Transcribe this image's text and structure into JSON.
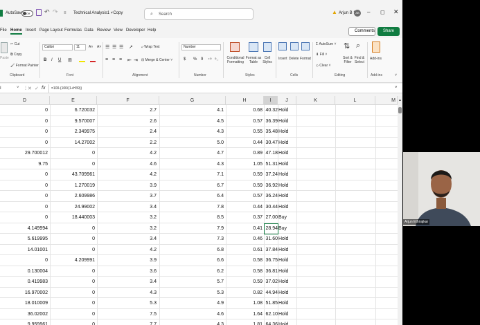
{
  "titlebar": {
    "autosave_label": "AutoSave",
    "autosave_state": "Off",
    "doc_title": "Technical Analysis1 - Copy",
    "search_placeholder": "Search",
    "user_name": "Arjun B S",
    "user_initials": "AB"
  },
  "tabs": [
    "File",
    "Home",
    "Insert",
    "Page Layout",
    "Formulas",
    "Data",
    "Review",
    "View",
    "Developer",
    "Help"
  ],
  "active_tab": "Home",
  "comments_label": "Comments",
  "share_label": "Share",
  "ribbon": {
    "clipboard": {
      "cut": "Cut",
      "copy": "Copy",
      "paste": "Paste",
      "format_painter": "Format Painter",
      "group": "Clipboard"
    },
    "font": {
      "name": "Calibri",
      "size": "11",
      "group": "Font",
      "bold": "B",
      "italic": "I",
      "underline": "U",
      "grow": "A˄",
      "shrink": "A˅"
    },
    "alignment": {
      "wrap": "Wrap Text",
      "merge": "Merge & Center",
      "group": "Alignment"
    },
    "number": {
      "format": "Number",
      "currency": "$",
      "percent": "%",
      "comma": "9",
      "group": "Number"
    },
    "styles": {
      "conditional": "Conditional Formatting",
      "format_as_table": "Format as Table",
      "cell_styles": "Cell Styles",
      "group": "Styles"
    },
    "cells": {
      "insert": "Insert",
      "delete": "Delete",
      "format": "Format",
      "group": "Cells"
    },
    "editing": {
      "autosum": "AutoSum",
      "fill": "Fill",
      "clear": "Clear",
      "sort": "Sort & Filter",
      "find": "Find & Select",
      "group": "Editing"
    },
    "addins": {
      "label": "Add-ins",
      "group": "Add-ins"
    }
  },
  "formula_bar": {
    "name_box": "I",
    "fx": "fx",
    "formula": "=100-(100/(1+H39))"
  },
  "columns": [
    "D",
    "E",
    "F",
    "G",
    "H",
    "I",
    "J",
    "K",
    "L",
    "M"
  ],
  "selected_column": "I",
  "rows": [
    [
      "0",
      "6.720032",
      "2.7",
      "4.1",
      "0.68",
      "40.32",
      "Hold"
    ],
    [
      "0",
      "9.570007",
      "2.6",
      "4.5",
      "0.57",
      "36.39",
      "Hold"
    ],
    [
      "0",
      "2.349975",
      "2.4",
      "4.3",
      "0.55",
      "35.48",
      "Hold"
    ],
    [
      "0",
      "14.27002",
      "2.2",
      "5.0",
      "0.44",
      "30.47",
      "Hold"
    ],
    [
      "29.700012",
      "0",
      "4.2",
      "4.7",
      "0.89",
      "47.18",
      "Hold"
    ],
    [
      "9.75",
      "0",
      "4.6",
      "4.3",
      "1.05",
      "51.31",
      "Hold"
    ],
    [
      "0",
      "43.709961",
      "4.2",
      "7.1",
      "0.59",
      "37.24",
      "Hold"
    ],
    [
      "0",
      "1.270019",
      "3.9",
      "6.7",
      "0.59",
      "36.92",
      "Hold"
    ],
    [
      "0",
      "2.609986",
      "3.7",
      "6.4",
      "0.57",
      "36.24",
      "Hold"
    ],
    [
      "0",
      "24.99002",
      "3.4",
      "7.8",
      "0.44",
      "30.44",
      "Hold"
    ],
    [
      "0",
      "18.440003",
      "3.2",
      "8.5",
      "0.37",
      "27.00",
      "Buy"
    ],
    [
      "4.149994",
      "0",
      "3.2",
      "7.9",
      "0.41",
      "28.94",
      "Buy"
    ],
    [
      "5.619995",
      "0",
      "3.4",
      "7.3",
      "0.46",
      "31.60",
      "Hold"
    ],
    [
      "14.01001",
      "0",
      "4.2",
      "6.8",
      "0.61",
      "37.84",
      "Hold"
    ],
    [
      "0",
      "4.209991",
      "3.9",
      "6.6",
      "0.58",
      "36.75",
      "Hold"
    ],
    [
      "0.130004",
      "0",
      "3.6",
      "6.2",
      "0.58",
      "36.81",
      "Hold"
    ],
    [
      "0.419983",
      "0",
      "3.4",
      "5.7",
      "0.59",
      "37.02",
      "Hold"
    ],
    [
      "16.970002",
      "0",
      "4.3",
      "5.3",
      "0.82",
      "44.94",
      "Hold"
    ],
    [
      "18.010009",
      "0",
      "5.3",
      "4.9",
      "1.08",
      "51.85",
      "Hold"
    ],
    [
      "36.02002",
      "0",
      "7.5",
      "4.6",
      "1.64",
      "62.10",
      "Hold"
    ],
    [
      "9.959961",
      "0",
      "7.7",
      "4.3",
      "1.81",
      "64.36",
      "Hold"
    ]
  ],
  "selected_row_index": 11,
  "webcam": {
    "name_label": "Arjun Ethirajkar"
  }
}
